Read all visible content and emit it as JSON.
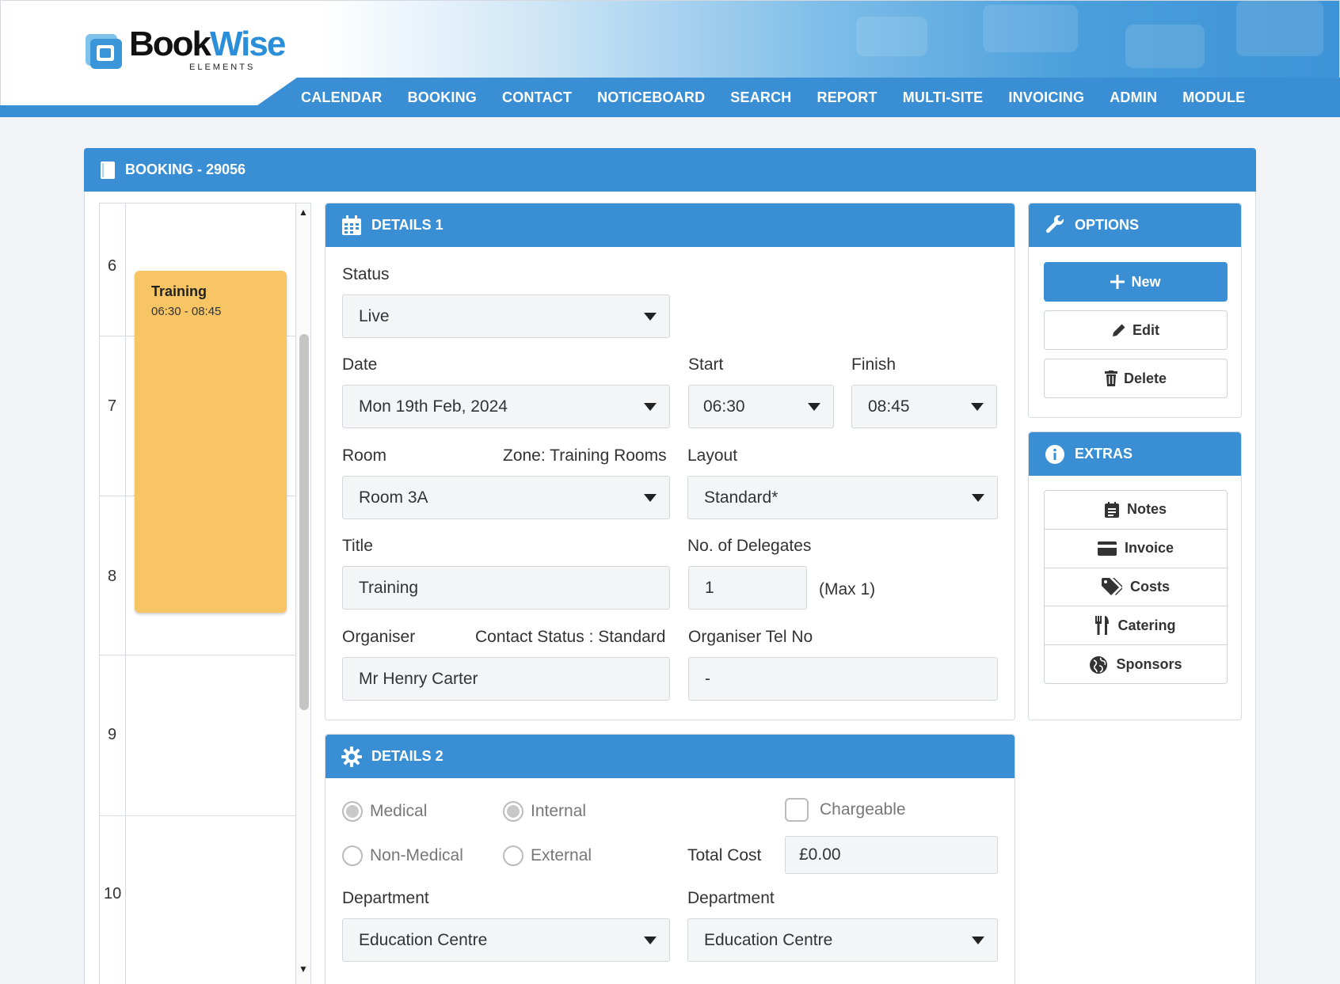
{
  "app": {
    "logo_main": "BookWise",
    "logo_sub": "ELEMENTS",
    "brand_color": "#3a8fd4"
  },
  "nav": {
    "items": [
      "CALENDAR",
      "BOOKING",
      "CONTACT",
      "NOTICEBOARD",
      "SEARCH",
      "REPORT",
      "MULTI-SITE",
      "INVOICING",
      "ADMIN",
      "MODULE"
    ]
  },
  "booking": {
    "header": "BOOKING - 29056"
  },
  "calendar": {
    "hours": [
      "6",
      "7",
      "8",
      "9",
      "10"
    ],
    "event": {
      "title": "Training",
      "time": "06:30 - 08:45",
      "color": "#f8c564"
    }
  },
  "details1": {
    "title": "DETAILS 1",
    "status_label": "Status",
    "status_value": "Live",
    "date_label": "Date",
    "date_value": "Mon 19th Feb, 2024",
    "start_label": "Start",
    "start_value": "06:30",
    "finish_label": "Finish",
    "finish_value": "08:45",
    "room_label": "Room",
    "zone_text": "Zone: Training Rooms",
    "room_value": "Room 3A",
    "layout_label": "Layout",
    "layout_value": "Standard*",
    "title_label": "Title",
    "title_value": "Training",
    "delegates_label": "No. of Delegates",
    "delegates_value": "1",
    "delegates_max": "(Max 1)",
    "organiser_label": "Organiser",
    "contact_status": "Contact Status : Standard",
    "organiser_value": "Mr Henry Carter",
    "organiser_tel_label": "Organiser Tel No",
    "organiser_tel_value": "-"
  },
  "details2": {
    "title": "DETAILS 2",
    "radio_medical": "Medical",
    "radio_non_medical": "Non-Medical",
    "radio_internal": "Internal",
    "radio_external": "External",
    "chargeable_label": "Chargeable",
    "total_cost_label": "Total Cost",
    "total_cost_value": "£0.00",
    "department_label_1": "Department",
    "department_value_1": "Education Centre",
    "department_label_2": "Department",
    "department_value_2": "Education Centre"
  },
  "options": {
    "title": "OPTIONS",
    "new_label": "New",
    "edit_label": "Edit",
    "delete_label": "Delete"
  },
  "extras": {
    "title": "EXTRAS",
    "items": [
      "Notes",
      "Invoice",
      "Costs",
      "Catering",
      "Sponsors"
    ]
  }
}
